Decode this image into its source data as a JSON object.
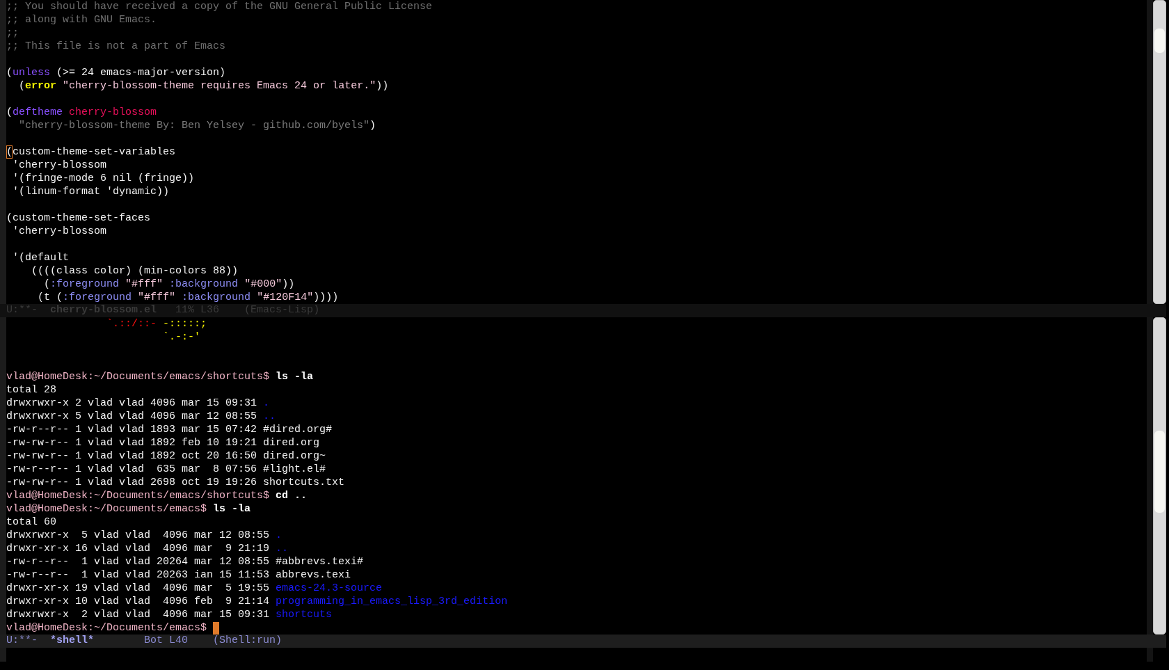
{
  "code_window": {
    "lines": [
      {
        "kind": "text",
        "segments": [
          {
            "kind": "comment",
            "text": ";; You should have received a copy of the GNU General Public License"
          }
        ]
      },
      {
        "kind": "text",
        "segments": [
          {
            "kind": "comment",
            "text": ";; along with GNU Emacs."
          }
        ]
      },
      {
        "kind": "text",
        "segments": [
          {
            "kind": "comment",
            "text": ";;"
          }
        ]
      },
      {
        "kind": "text",
        "segments": [
          {
            "kind": "comment",
            "text": ";; This file is not a part of Emacs"
          }
        ]
      },
      {
        "kind": "blank"
      },
      {
        "kind": "text",
        "segments": [
          {
            "kind": "plain",
            "text": "("
          },
          {
            "kind": "keyword",
            "text": "unless"
          },
          {
            "kind": "plain",
            "text": " (>= 24 emacs-major-version)"
          }
        ]
      },
      {
        "kind": "text",
        "segments": [
          {
            "kind": "plain",
            "text": "  ("
          },
          {
            "kind": "warning",
            "text": "error"
          },
          {
            "kind": "string",
            "text": " \"cherry-blossom-theme requires Emacs 24 or later.\""
          },
          {
            "kind": "plain",
            "text": "))"
          }
        ]
      },
      {
        "kind": "blank"
      },
      {
        "kind": "text",
        "segments": [
          {
            "kind": "plain",
            "text": "("
          },
          {
            "kind": "keyword",
            "text": "deftheme"
          },
          {
            "kind": "name",
            "text": " cherry-blossom"
          }
        ]
      },
      {
        "kind": "text",
        "segments": [
          {
            "kind": "doc",
            "text": "  \"cherry-blossom-theme By: Ben Yelsey - github.com/byels\""
          },
          {
            "kind": "plain",
            "text": ")"
          }
        ]
      },
      {
        "kind": "blank"
      },
      {
        "kind": "text",
        "segments": [
          {
            "kind": "cursor",
            "text": "("
          },
          {
            "kind": "plain",
            "text": "custom-theme-set-variables"
          }
        ]
      },
      {
        "kind": "text",
        "segments": [
          {
            "kind": "plain",
            "text": " 'cherry-blossom"
          }
        ]
      },
      {
        "kind": "text",
        "segments": [
          {
            "kind": "plain",
            "text": " '(fringe-mode 6 nil (fringe))"
          }
        ]
      },
      {
        "kind": "text",
        "segments": [
          {
            "kind": "plain",
            "text": " '(linum-format 'dynamic))"
          }
        ]
      },
      {
        "kind": "blank"
      },
      {
        "kind": "text",
        "segments": [
          {
            "kind": "plain",
            "text": "(custom-theme-set-faces"
          }
        ]
      },
      {
        "kind": "text",
        "segments": [
          {
            "kind": "plain",
            "text": " 'cherry-blossom"
          }
        ]
      },
      {
        "kind": "blank"
      },
      {
        "kind": "text",
        "segments": [
          {
            "kind": "plain",
            "text": " '(default"
          }
        ]
      },
      {
        "kind": "text",
        "segments": [
          {
            "kind": "plain",
            "text": "    ((((class color) (min-colors 88))"
          }
        ]
      },
      {
        "kind": "text",
        "segments": [
          {
            "kind": "plain",
            "text": "      ("
          },
          {
            "kind": "constant",
            "text": ":foreground"
          },
          {
            "kind": "string",
            "text": " \"#fff\""
          },
          {
            "kind": "constant",
            "text": " :background"
          },
          {
            "kind": "string",
            "text": " \"#000\""
          },
          {
            "kind": "plain",
            "text": "))"
          }
        ]
      },
      {
        "kind": "text",
        "segments": [
          {
            "kind": "plain",
            "text": "     (t ("
          },
          {
            "kind": "constant",
            "text": ":foreground"
          },
          {
            "kind": "string",
            "text": " \"#fff\""
          },
          {
            "kind": "constant",
            "text": " :background"
          },
          {
            "kind": "string",
            "text": " \"#120F14\""
          },
          {
            "kind": "plain",
            "text": "))))"
          }
        ]
      }
    ],
    "mode_line": {
      "active": false,
      "segments": [
        {
          "kind": "plain",
          "text": "U:**-"
        },
        {
          "kind": "buffer",
          "text": "  cherry-blossom.el"
        },
        {
          "kind": "plain",
          "text": "   11% L36"
        },
        {
          "kind": "plain",
          "text": "    (Emacs-Lisp)"
        }
      ]
    }
  },
  "shell_window": {
    "lines": [
      {
        "kind": "text",
        "segments": [
          {
            "kind": "art-red",
            "text": "                `.::/::-"
          },
          {
            "kind": "art-yellow",
            "text": " -:::::;"
          }
        ]
      },
      {
        "kind": "text",
        "segments": [
          {
            "kind": "art-yellow",
            "text": "                         `.-:-'"
          }
        ]
      },
      {
        "kind": "blank"
      },
      {
        "kind": "blank"
      },
      {
        "kind": "text",
        "segments": [
          {
            "kind": "prompt",
            "text": "vlad@HomeDesk:~/Documents/emacs/shortcuts$"
          },
          {
            "kind": "command",
            "text": " ls -la"
          }
        ]
      },
      {
        "kind": "text",
        "segments": [
          {
            "kind": "plain",
            "text": "total 28"
          }
        ]
      },
      {
        "kind": "text",
        "segments": [
          {
            "kind": "plain",
            "text": "drwxrwxr-x 2 vlad vlad 4096 mar 15 09:31"
          },
          {
            "kind": "directory",
            "text": " ."
          }
        ]
      },
      {
        "kind": "text",
        "segments": [
          {
            "kind": "plain",
            "text": "drwxrwxr-x 5 vlad vlad 4096 mar 12 08:55"
          },
          {
            "kind": "directory",
            "text": " .."
          }
        ]
      },
      {
        "kind": "text",
        "segments": [
          {
            "kind": "plain",
            "text": "-rw-r--r-- 1 vlad vlad 1893 mar 15 07:42 #dired.org#"
          }
        ]
      },
      {
        "kind": "text",
        "segments": [
          {
            "kind": "plain",
            "text": "-rw-rw-r-- 1 vlad vlad 1892 feb 10 19:21 dired.org"
          }
        ]
      },
      {
        "kind": "text",
        "segments": [
          {
            "kind": "plain",
            "text": "-rw-rw-r-- 1 vlad vlad 1892 oct 20 16:50 dired.org~"
          }
        ]
      },
      {
        "kind": "text",
        "segments": [
          {
            "kind": "plain",
            "text": "-rw-r--r-- 1 vlad vlad  635 mar  8 07:56 #light.el#"
          }
        ]
      },
      {
        "kind": "text",
        "segments": [
          {
            "kind": "plain",
            "text": "-rw-rw-r-- 1 vlad vlad 2698 oct 19 19:26 shortcuts.txt"
          }
        ]
      },
      {
        "kind": "text",
        "segments": [
          {
            "kind": "prompt",
            "text": "vlad@HomeDesk:~/Documents/emacs/shortcuts$"
          },
          {
            "kind": "command",
            "text": " cd .."
          }
        ]
      },
      {
        "kind": "text",
        "segments": [
          {
            "kind": "prompt",
            "text": "vlad@HomeDesk:~/Documents/emacs$"
          },
          {
            "kind": "command",
            "text": " ls -la"
          }
        ]
      },
      {
        "kind": "text",
        "segments": [
          {
            "kind": "plain",
            "text": "total 60"
          }
        ]
      },
      {
        "kind": "text",
        "segments": [
          {
            "kind": "plain",
            "text": "drwxrwxr-x  5 vlad vlad  4096 mar 12 08:55"
          },
          {
            "kind": "directory",
            "text": " ."
          }
        ]
      },
      {
        "kind": "text",
        "segments": [
          {
            "kind": "plain",
            "text": "drwxr-xr-x 16 vlad vlad  4096 mar  9 21:19"
          },
          {
            "kind": "directory",
            "text": " .."
          }
        ]
      },
      {
        "kind": "text",
        "segments": [
          {
            "kind": "plain",
            "text": "-rw-r--r--  1 vlad vlad 20264 mar 12 08:55 #abbrevs.texi#"
          }
        ]
      },
      {
        "kind": "text",
        "segments": [
          {
            "kind": "plain",
            "text": "-rw-r--r--  1 vlad vlad 20263 ian 15 11:53 abbrevs.texi"
          }
        ]
      },
      {
        "kind": "text",
        "segments": [
          {
            "kind": "plain",
            "text": "drwxr-xr-x 19 vlad vlad  4096 mar  5 19:55"
          },
          {
            "kind": "directory",
            "text": " emacs-24.3-source"
          }
        ]
      },
      {
        "kind": "text",
        "segments": [
          {
            "kind": "plain",
            "text": "drwxr-xr-x 10 vlad vlad  4096 feb  9 21:14"
          },
          {
            "kind": "directory",
            "text": " programming_in_emacs_lisp_3rd_edition"
          }
        ]
      },
      {
        "kind": "text",
        "segments": [
          {
            "kind": "plain",
            "text": "drwxrwxr-x  2 vlad vlad  4096 mar 15 09:31"
          },
          {
            "kind": "directory",
            "text": " shortcuts"
          }
        ]
      },
      {
        "kind": "text",
        "segments": [
          {
            "kind": "prompt",
            "text": "vlad@HomeDesk:~/Documents/emacs$"
          },
          {
            "kind": "block-cursor"
          }
        ]
      }
    ],
    "mode_line": {
      "active": true,
      "segments": [
        {
          "kind": "plain",
          "text": "U:**-"
        },
        {
          "kind": "buffer",
          "text": "  *shell*"
        },
        {
          "kind": "plain",
          "text": "        Bot L40"
        },
        {
          "kind": "plain",
          "text": "    (Shell:run)"
        }
      ]
    }
  }
}
